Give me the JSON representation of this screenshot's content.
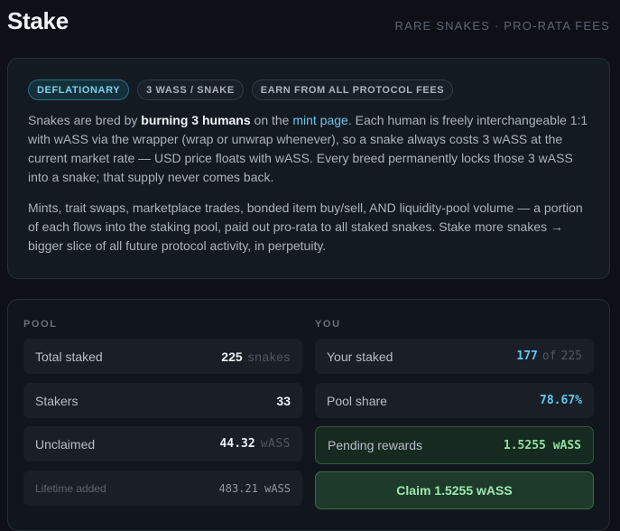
{
  "header": {
    "title": "Stake",
    "tagline": "RARE SNAKES · PRO-RATA FEES"
  },
  "info": {
    "pills": [
      "DEFLATIONARY",
      "3 WASS / SNAKE",
      "EARN FROM ALL PROTOCOL FEES"
    ],
    "p1_a": "Snakes are bred by ",
    "p1_bold": "burning 3 humans",
    "p1_b": " on the ",
    "p1_link": "mint page",
    "p1_c": ". Each human is freely interchangeable 1:1 with wASS via the wrapper (wrap or unwrap whenever), so a snake always costs 3 wASS at the current market rate — USD price floats with wASS. Every breed permanently locks those 3 wASS into a snake; that supply never comes back.",
    "p2": "Mints, trait swaps, marketplace trades, bonded item buy/sell, AND liquidity-pool volume — a portion of each flows into the staking pool, paid out pro-rata to all staked snakes. Stake more snakes → bigger slice of all future protocol activity, in perpetuity."
  },
  "pool": {
    "heading": "POOL",
    "total_staked_label": "Total staked",
    "total_staked_value": "225",
    "total_staked_unit": "snakes",
    "stakers_label": "Stakers",
    "stakers_value": "33",
    "unclaimed_label": "Unclaimed",
    "unclaimed_value": "44.32",
    "unclaimed_unit": "wASS",
    "lifetime_label": "Lifetime added",
    "lifetime_value": "483.21 wASS"
  },
  "you": {
    "heading": "YOU",
    "staked_label": "Your staked",
    "staked_value": "177",
    "staked_of": "of",
    "staked_total": "225",
    "share_label": "Pool share",
    "share_value": "78.67%",
    "pending_label": "Pending rewards",
    "pending_value": "1.5255 wASS",
    "claim_label": "Claim 1.5255 wASS"
  }
}
